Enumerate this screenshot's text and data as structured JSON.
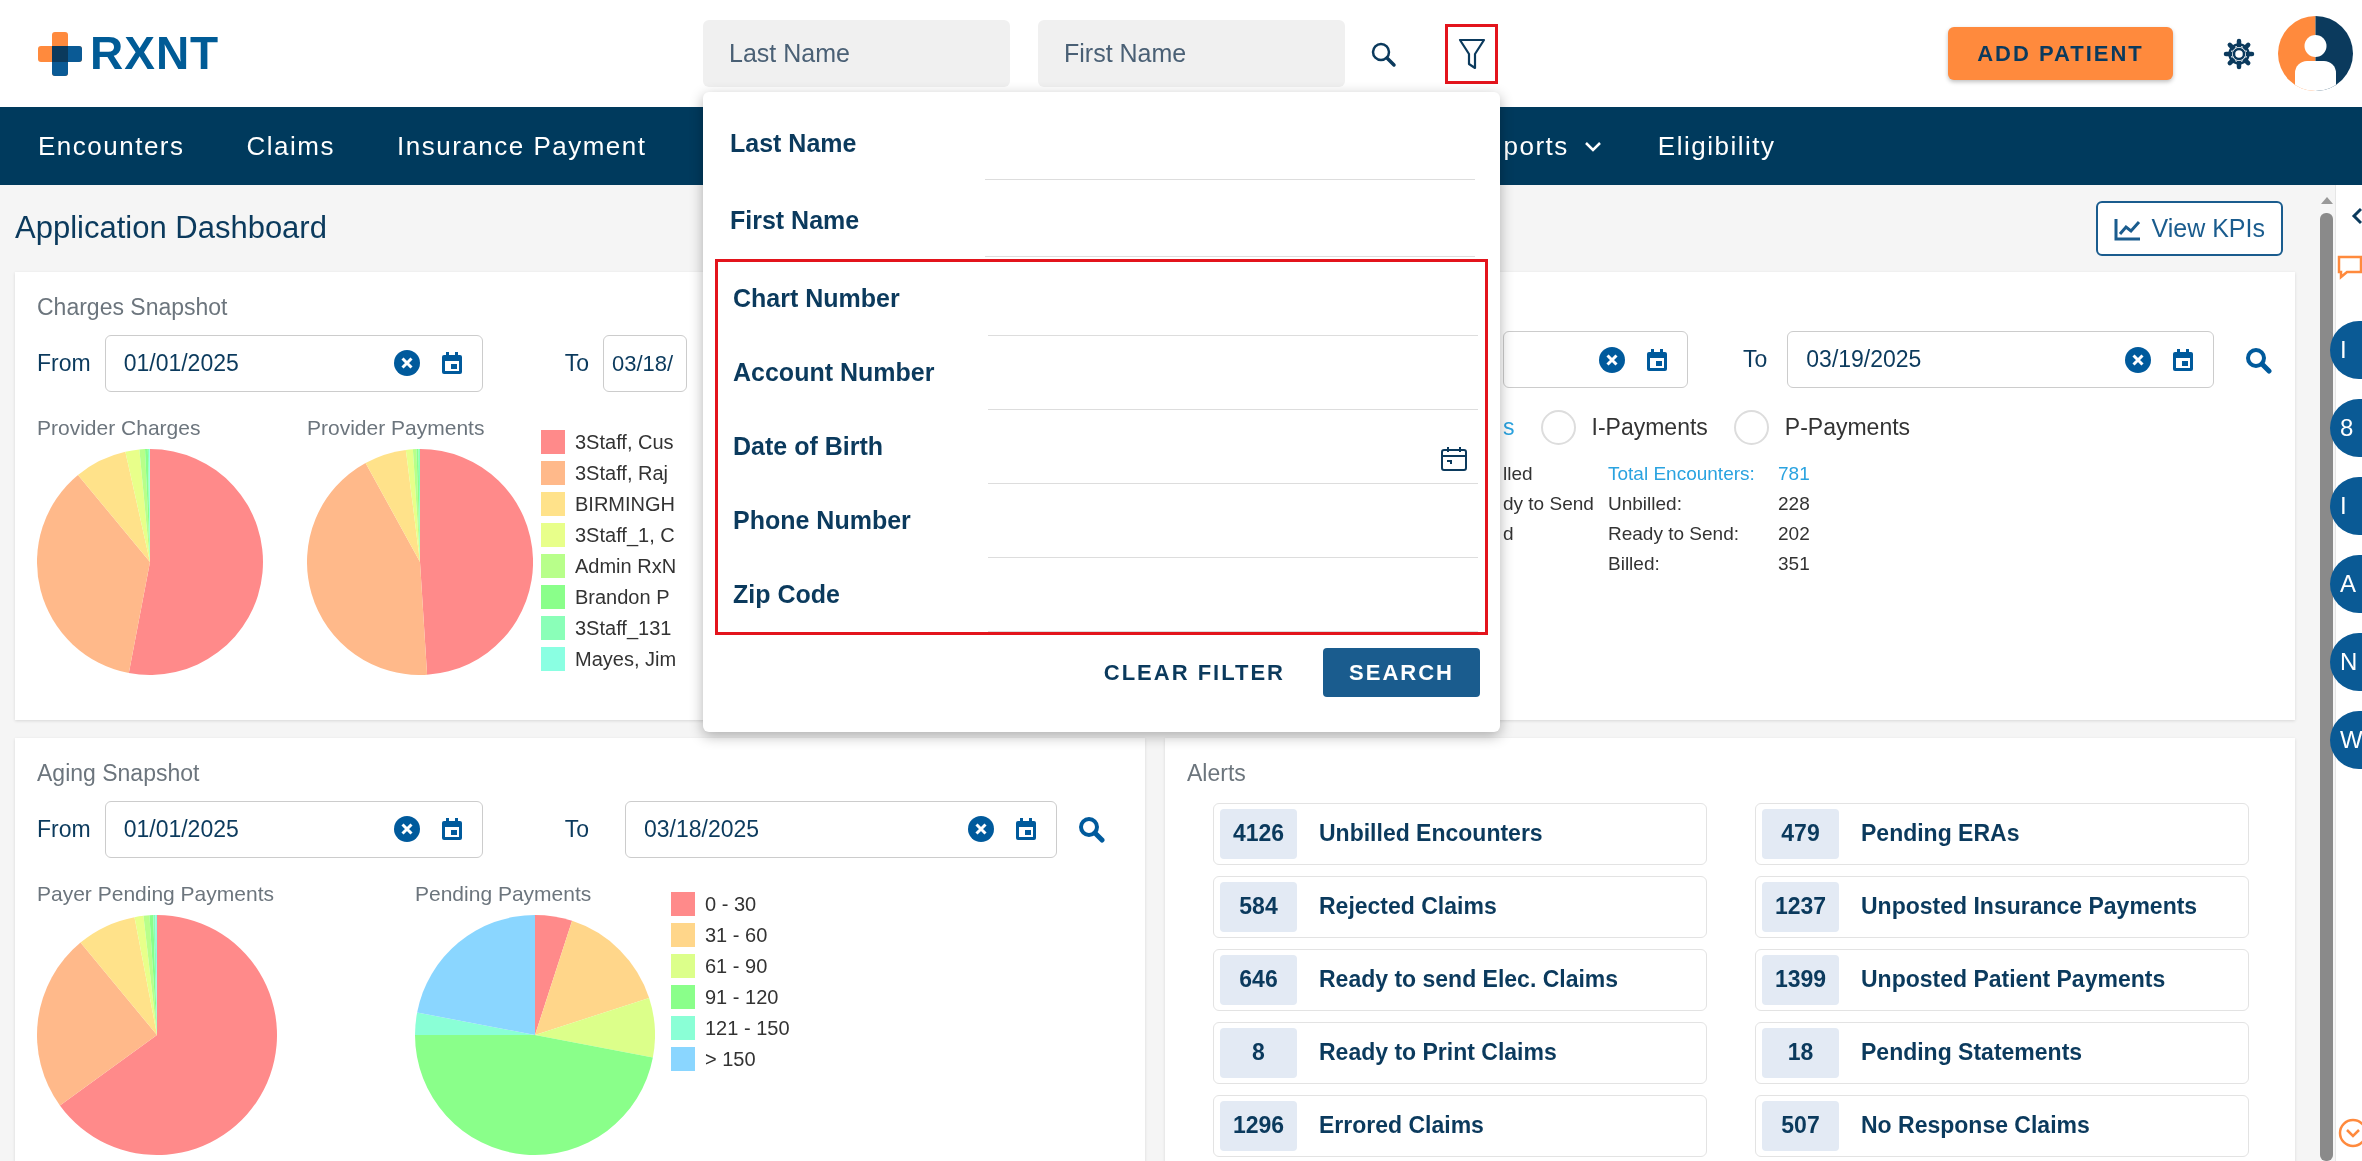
{
  "header": {
    "logo_text": "RXNT",
    "search_fields": [
      {
        "placeholder": "Last Name"
      },
      {
        "placeholder": "First Name"
      }
    ],
    "filter_button": {
      "highlighted": true
    },
    "add_button": "ADD PATIENT"
  },
  "nav": [
    {
      "label": "Encounters",
      "dropdown": false
    },
    {
      "label": "Claims",
      "dropdown": false
    },
    {
      "label": "Insurance Payment",
      "dropdown": false
    },
    {
      "label": "ports",
      "dropdown": true
    },
    {
      "label": "Eligibility",
      "dropdown": false
    }
  ],
  "page_title": "Application Dashboard",
  "kpi_button": "View KPIs",
  "filter_panel": {
    "fields": [
      {
        "label": "Last Name",
        "kind": "text",
        "highlighted": false
      },
      {
        "label": "First Name",
        "kind": "text",
        "highlighted": false
      },
      {
        "label": "Chart Number",
        "kind": "text",
        "highlighted": true
      },
      {
        "label": "Account Number",
        "kind": "text",
        "highlighted": true
      },
      {
        "label": "Date of Birth",
        "kind": "date",
        "highlighted": true
      },
      {
        "label": "Phone Number",
        "kind": "text",
        "highlighted": true
      },
      {
        "label": "Zip Code",
        "kind": "text",
        "highlighted": true
      }
    ],
    "buttons": [
      {
        "label": "CLEAR FILTER",
        "kind": "link"
      },
      {
        "label": "SEARCH",
        "kind": "primary"
      }
    ]
  },
  "charges": {
    "title": "Charges Snapshot",
    "from_label": "From",
    "from_value": "01/01/2025",
    "to_label": "To",
    "to_value": "03/18/",
    "charts": [
      {
        "title": "Provider Charges"
      },
      {
        "title": "Provider Payments"
      }
    ],
    "legend": [
      {
        "label": "3Staff, Cus",
        "color": "#ff8a8a"
      },
      {
        "label": "3Staff, Raj",
        "color": "#ffb98a"
      },
      {
        "label": "BIRMINGH",
        "color": "#ffe28a"
      },
      {
        "label": "3Staff_1, C",
        "color": "#e8ff8a"
      },
      {
        "label": "Admin RxN",
        "color": "#b8ff8a"
      },
      {
        "label": "Brandon P",
        "color": "#8aff8a"
      },
      {
        "label": "3Staff_131",
        "color": "#8affb8"
      },
      {
        "label": "Mayes, Jim",
        "color": "#8affe2"
      }
    ]
  },
  "encounters": {
    "to_label": "To",
    "to_value": "03/19/2025",
    "radios": [
      {
        "label": "s",
        "selected": true
      },
      {
        "label": "I-Payments",
        "selected": false
      },
      {
        "label": "P-Payments",
        "selected": false
      }
    ],
    "legend": [
      {
        "label": "lled"
      },
      {
        "label": "dy to Send"
      },
      {
        "label": "d"
      }
    ],
    "stats": [
      {
        "label": "Total Encounters:",
        "value": "781",
        "highlighted": true
      },
      {
        "label": "Unbilled:",
        "value": "228",
        "highlighted": false
      },
      {
        "label": "Ready to Send:",
        "value": "202",
        "highlighted": false
      },
      {
        "label": "Billed:",
        "value": "351",
        "highlighted": false
      }
    ]
  },
  "aging": {
    "title": "Aging Snapshot",
    "from_label": "From",
    "from_value": "01/01/2025",
    "to_label": "To",
    "to_value": "03/18/2025",
    "charts": [
      {
        "title": "Payer Pending Payments"
      },
      {
        "title": "Pending Payments"
      }
    ],
    "legend": [
      {
        "label": "0 - 30",
        "color": "#ff8a8a"
      },
      {
        "label": "31 - 60",
        "color": "#ffd68a"
      },
      {
        "label": "61 - 90",
        "color": "#dcff8a"
      },
      {
        "label": "91 - 120",
        "color": "#8aff8a"
      },
      {
        "label": "121 - 150",
        "color": "#8affd6"
      },
      {
        "label": "> 150",
        "color": "#8ad6ff"
      }
    ]
  },
  "alerts": {
    "title": "Alerts",
    "items": [
      {
        "count": "4126",
        "label": "Unbilled Encounters"
      },
      {
        "count": "479",
        "label": "Pending ERAs"
      },
      {
        "count": "584",
        "label": "Rejected Claims"
      },
      {
        "count": "1237",
        "label": "Unposted Insurance Payments"
      },
      {
        "count": "646",
        "label": "Ready to send Elec. Claims"
      },
      {
        "count": "1399",
        "label": "Unposted Patient Payments"
      },
      {
        "count": "8",
        "label": "Ready to Print Claims"
      },
      {
        "count": "18",
        "label": "Pending Statements"
      },
      {
        "count": "1296",
        "label": "Errored Claims"
      },
      {
        "count": "507",
        "label": "No Response Claims"
      }
    ]
  },
  "right_rail": {
    "badges": [
      "I",
      "8",
      "I",
      "A",
      "N",
      "W"
    ]
  }
}
